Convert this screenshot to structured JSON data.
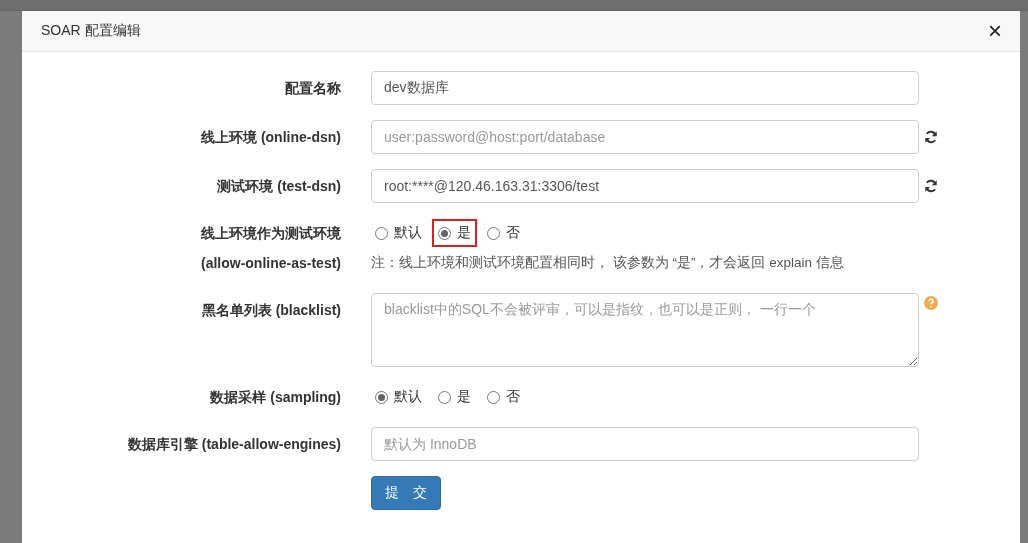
{
  "dialog": {
    "title": "SOAR 配置编辑",
    "close": "×"
  },
  "fields": [
    {
      "kind": "input",
      "label": "配置名称",
      "value": "dev数据库"
    },
    {
      "kind": "input",
      "label": "线上环境 (online-dsn)",
      "placeholder": "user:password@host:port/database",
      "refresh": true
    },
    {
      "kind": "input",
      "label": "测试环境 (test-dsn)",
      "value": "root:****@120.46.163.31:3306/test",
      "refresh": true
    },
    {
      "kind": "radio",
      "label": "线上环境作为测试环境",
      "sublabel": "(allow-online-as-test)",
      "options": [
        {
          "label": "默认",
          "selected": false,
          "highlighted": false
        },
        {
          "label": "是",
          "selected": true,
          "highlighted": true
        },
        {
          "label": "否",
          "selected": false,
          "highlighted": false
        }
      ],
      "note": "注：线上环境和测试环境配置相同时， 该参数为 “是”，才会返回 explain 信息"
    },
    {
      "kind": "textarea",
      "label": "黑名单列表 (blacklist)",
      "placeholder": "blacklist中的SQL不会被评审，可以是指纹，也可以是正则， 一行一个",
      "help": true
    },
    {
      "kind": "radio",
      "label": "数据采样 (sampling)",
      "options": [
        {
          "label": "默认",
          "selected": true,
          "highlighted": false
        },
        {
          "label": "是",
          "selected": false,
          "highlighted": false
        },
        {
          "label": "否",
          "selected": false,
          "highlighted": false
        }
      ]
    },
    {
      "kind": "input",
      "label": "数据库引擎 (table-allow-engines)",
      "placeholder": "默认为 InnoDB"
    }
  ],
  "submit": "提　交"
}
